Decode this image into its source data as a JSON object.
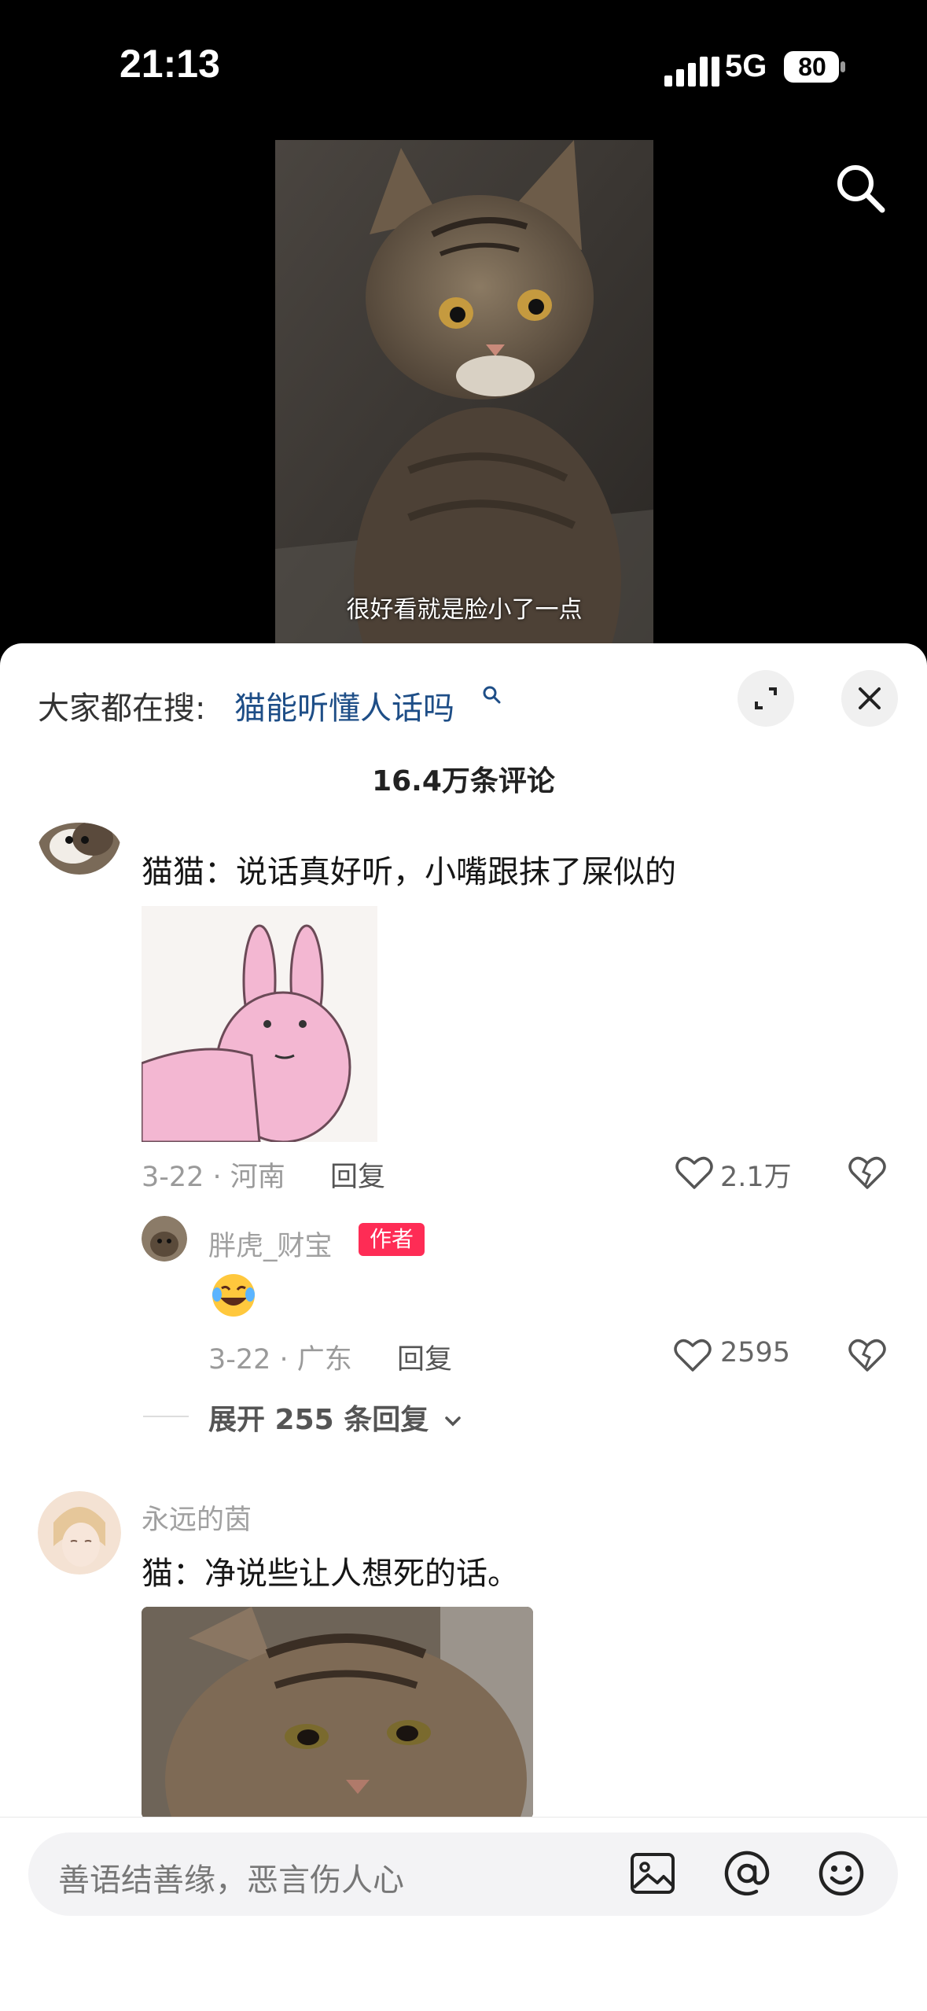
{
  "status_bar": {
    "time": "21:13",
    "network": "5G",
    "battery": "80"
  },
  "video": {
    "subtitle": "很好看就是脸小了一点"
  },
  "comments_panel": {
    "hot_search_prefix": "大家都在搜:",
    "hot_search_query": "猫能听懂人话吗",
    "comment_count": "16.4万条评论",
    "comments": [
      {
        "text": "猫猫：说话真好听，小嘴跟抹了屎似的",
        "date_location": "3-22 · 河南",
        "reply_label": "回复",
        "likes": "2.1万",
        "replies": [
          {
            "username": "胖虎_财宝",
            "badge": "作者",
            "date_location": "3-22 · 广东",
            "reply_label": "回复",
            "likes": "2595"
          }
        ],
        "expand_label": "展开 255 条回复"
      },
      {
        "username": "永远的茵",
        "text": "猫：净说些让人想死的话。"
      }
    ]
  },
  "input": {
    "placeholder": "善语结善缘，恶言伤人心"
  },
  "icons": [
    "search-icon",
    "expand-icon",
    "close-icon",
    "heart-icon",
    "broken-heart-icon",
    "image-icon",
    "at-icon",
    "emoji-icon",
    "chevron-down-icon"
  ]
}
